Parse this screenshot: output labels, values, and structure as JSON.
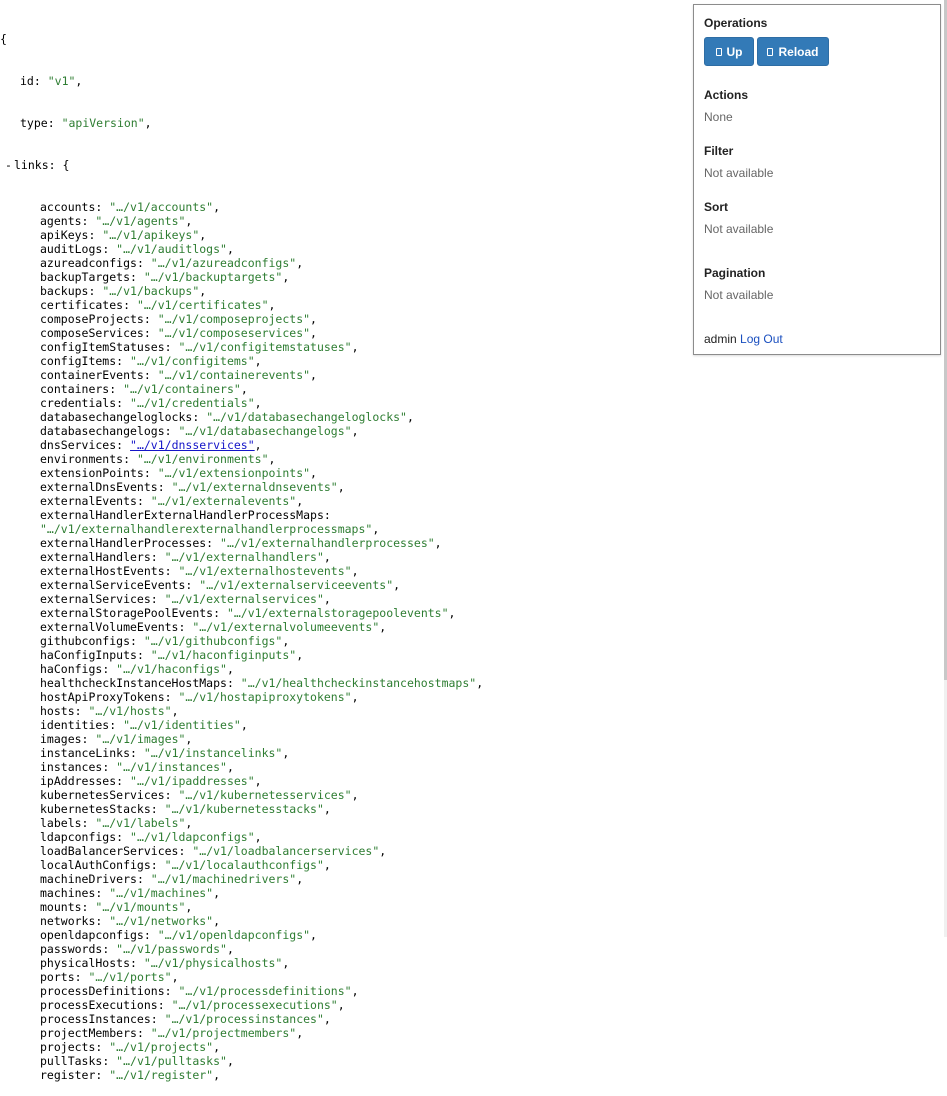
{
  "json_view": {
    "open_brace": "{",
    "id_key": "id",
    "id_value": "\"v1\"",
    "type_key": "type",
    "type_value": "\"apiVersion\"",
    "collapse_toggle": "-",
    "links_key": "links",
    "links": [
      {
        "key": "accounts",
        "value": "\"…/v1/accounts\""
      },
      {
        "key": "agents",
        "value": "\"…/v1/agents\""
      },
      {
        "key": "apiKeys",
        "value": "\"…/v1/apikeys\""
      },
      {
        "key": "auditLogs",
        "value": "\"…/v1/auditlogs\""
      },
      {
        "key": "azureadconfigs",
        "value": "\"…/v1/azureadconfigs\""
      },
      {
        "key": "backupTargets",
        "value": "\"…/v1/backuptargets\""
      },
      {
        "key": "backups",
        "value": "\"…/v1/backups\""
      },
      {
        "key": "certificates",
        "value": "\"…/v1/certificates\""
      },
      {
        "key": "composeProjects",
        "value": "\"…/v1/composeprojects\""
      },
      {
        "key": "composeServices",
        "value": "\"…/v1/composeservices\""
      },
      {
        "key": "configItemStatuses",
        "value": "\"…/v1/configitemstatuses\""
      },
      {
        "key": "configItems",
        "value": "\"…/v1/configitems\""
      },
      {
        "key": "containerEvents",
        "value": "\"…/v1/containerevents\""
      },
      {
        "key": "containers",
        "value": "\"…/v1/containers\""
      },
      {
        "key": "credentials",
        "value": "\"…/v1/credentials\""
      },
      {
        "key": "databasechangeloglocks",
        "value": "\"…/v1/databasechangeloglocks\""
      },
      {
        "key": "databasechangelogs",
        "value": "\"…/v1/databasechangelogs\""
      },
      {
        "key": "dnsServices",
        "value": "\"…/v1/dnsservices\"",
        "hover": true
      },
      {
        "key": "environments",
        "value": "\"…/v1/environments\""
      },
      {
        "key": "extensionPoints",
        "value": "\"…/v1/extensionpoints\""
      },
      {
        "key": "externalDnsEvents",
        "value": "\"…/v1/externaldnsevents\""
      },
      {
        "key": "externalEvents",
        "value": "\"…/v1/externalevents\""
      },
      {
        "key": "externalHandlerExternalHandlerProcessMaps",
        "value": "\"…/v1/externalhandlerexternalhandlerprocessmaps\"",
        "wrap": true
      },
      {
        "key": "externalHandlerProcesses",
        "value": "\"…/v1/externalhandlerprocesses\""
      },
      {
        "key": "externalHandlers",
        "value": "\"…/v1/externalhandlers\""
      },
      {
        "key": "externalHostEvents",
        "value": "\"…/v1/externalhostevents\""
      },
      {
        "key": "externalServiceEvents",
        "value": "\"…/v1/externalserviceevents\""
      },
      {
        "key": "externalServices",
        "value": "\"…/v1/externalservices\""
      },
      {
        "key": "externalStoragePoolEvents",
        "value": "\"…/v1/externalstoragepoolevents\""
      },
      {
        "key": "externalVolumeEvents",
        "value": "\"…/v1/externalvolumeevents\""
      },
      {
        "key": "githubconfigs",
        "value": "\"…/v1/githubconfigs\""
      },
      {
        "key": "haConfigInputs",
        "value": "\"…/v1/haconfiginputs\""
      },
      {
        "key": "haConfigs",
        "value": "\"…/v1/haconfigs\""
      },
      {
        "key": "healthcheckInstanceHostMaps",
        "value": "\"…/v1/healthcheckinstancehostmaps\""
      },
      {
        "key": "hostApiProxyTokens",
        "value": "\"…/v1/hostapiproxytokens\""
      },
      {
        "key": "hosts",
        "value": "\"…/v1/hosts\""
      },
      {
        "key": "identities",
        "value": "\"…/v1/identities\""
      },
      {
        "key": "images",
        "value": "\"…/v1/images\""
      },
      {
        "key": "instanceLinks",
        "value": "\"…/v1/instancelinks\""
      },
      {
        "key": "instances",
        "value": "\"…/v1/instances\""
      },
      {
        "key": "ipAddresses",
        "value": "\"…/v1/ipaddresses\""
      },
      {
        "key": "kubernetesServices",
        "value": "\"…/v1/kubernetesservices\""
      },
      {
        "key": "kubernetesStacks",
        "value": "\"…/v1/kubernetesstacks\""
      },
      {
        "key": "labels",
        "value": "\"…/v1/labels\""
      },
      {
        "key": "ldapconfigs",
        "value": "\"…/v1/ldapconfigs\""
      },
      {
        "key": "loadBalancerServices",
        "value": "\"…/v1/loadbalancerservices\""
      },
      {
        "key": "localAuthConfigs",
        "value": "\"…/v1/localauthconfigs\""
      },
      {
        "key": "machineDrivers",
        "value": "\"…/v1/machinedrivers\""
      },
      {
        "key": "machines",
        "value": "\"…/v1/machines\""
      },
      {
        "key": "mounts",
        "value": "\"…/v1/mounts\""
      },
      {
        "key": "networks",
        "value": "\"…/v1/networks\""
      },
      {
        "key": "openldapconfigs",
        "value": "\"…/v1/openldapconfigs\""
      },
      {
        "key": "passwords",
        "value": "\"…/v1/passwords\""
      },
      {
        "key": "physicalHosts",
        "value": "\"…/v1/physicalhosts\""
      },
      {
        "key": "ports",
        "value": "\"…/v1/ports\""
      },
      {
        "key": "processDefinitions",
        "value": "\"…/v1/processdefinitions\""
      },
      {
        "key": "processExecutions",
        "value": "\"…/v1/processexecutions\""
      },
      {
        "key": "processInstances",
        "value": "\"…/v1/processinstances\""
      },
      {
        "key": "projectMembers",
        "value": "\"…/v1/projectmembers\""
      },
      {
        "key": "projects",
        "value": "\"…/v1/projects\""
      },
      {
        "key": "pullTasks",
        "value": "\"…/v1/pulltasks\""
      },
      {
        "key": "register",
        "value": "\"…/v1/register\""
      }
    ]
  },
  "panel": {
    "operations_title": "Operations",
    "up_label": "Up",
    "reload_label": "Reload",
    "actions_title": "Actions",
    "actions_value": "None",
    "filter_title": "Filter",
    "filter_value": "Not available",
    "sort_title": "Sort",
    "sort_value": "Not available",
    "pagination_title": "Pagination",
    "pagination_value": "Not available",
    "user": "admin",
    "logout_label": "Log Out"
  },
  "colors": {
    "string": "#2e7d32",
    "link_hover": "#1515c8",
    "button": "#337ab7",
    "logout_link": "#1a4fbf"
  }
}
